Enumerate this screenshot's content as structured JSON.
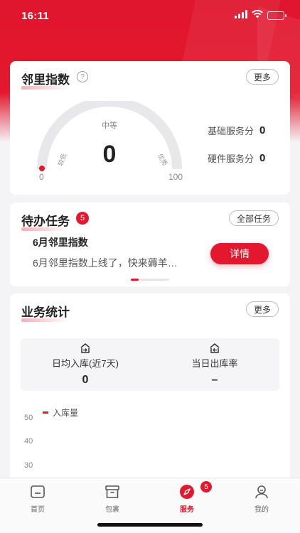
{
  "status_bar": {
    "time": "16:11"
  },
  "neighbor_index": {
    "title": "邻里指数",
    "more_label": "更多",
    "gauge": {
      "top_label": "中等",
      "left_label": "较低",
      "right_label": "优秀",
      "value": "0",
      "min": "0",
      "max": "100",
      "level": 0
    },
    "scores": [
      {
        "label": "基础服务分",
        "value": "0"
      },
      {
        "label": "硬件服务分",
        "value": "0"
      }
    ]
  },
  "todo": {
    "title": "待办任务",
    "badge": "5",
    "all_label": "全部任务",
    "item": {
      "title": "6月邻里指数",
      "desc": "6月邻里指数上线了，快来薅羊…",
      "button": "详情"
    }
  },
  "stats": {
    "title": "业务统计",
    "more_label": "更多",
    "cols": [
      {
        "icon": "inbound-icon",
        "label": "日均入库(近7天)",
        "value": "0"
      },
      {
        "icon": "outbound-icon",
        "label": "当日出库率",
        "value": "–"
      }
    ],
    "chart_legend": "入库量",
    "y_ticks": [
      "50",
      "40",
      "30"
    ]
  },
  "tabbar": {
    "items": [
      {
        "label": "首页",
        "icon": "home-icon"
      },
      {
        "label": "包裹",
        "icon": "package-icon"
      },
      {
        "label": "服务",
        "icon": "compass-icon",
        "badge": "5"
      },
      {
        "label": "我的",
        "icon": "profile-icon"
      }
    ]
  },
  "colors": {
    "accent": "#e3182f",
    "background": "#f4f4f6"
  }
}
